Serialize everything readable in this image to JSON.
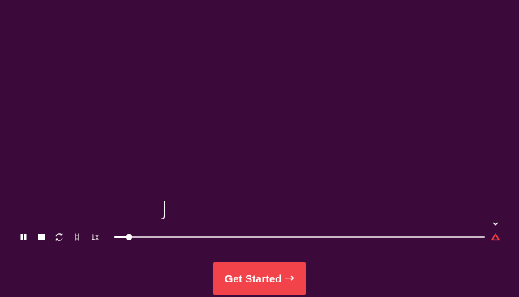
{
  "animation": {
    "glyph": "J",
    "progress_fraction": 0.04
  },
  "player": {
    "pause_icon": "pause-icon",
    "stop_icon": "stop-icon",
    "loop_icon": "loop-icon",
    "frames_icon": "frames-icon",
    "speed_label": "1x",
    "lottie_icon": "lottie-logo-icon",
    "collapse_icon": "chevron-down-icon"
  },
  "cta": {
    "label": "Get Started",
    "arrow": "→"
  },
  "colors": {
    "background": "#3c0a3a",
    "accent": "#f2434b",
    "foreground": "#ffffff",
    "track": "#c9b9c8"
  }
}
